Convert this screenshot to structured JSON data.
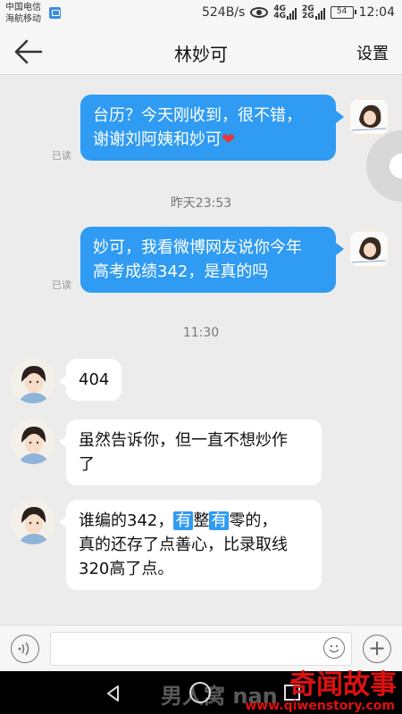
{
  "status_bar": {
    "carrier1": "中国电信",
    "carrier2": "海航移动",
    "net_speed": "524B/s",
    "network1": "4G",
    "network2": "4G",
    "network3": "2G",
    "network4": "2G",
    "battery": "54",
    "time": "12:04"
  },
  "header": {
    "title": "林妙可",
    "settings_label": "设置"
  },
  "messages": [
    {
      "line1": "台历？今天刚收到，很不错，",
      "line2": "谢谢刘阿姨和妙可",
      "heart": "❤",
      "status": "已读"
    },
    {
      "line1": "妙可，我看微博网友说你今年",
      "line2": "高考成绩342，是真的吗",
      "status": "已读"
    },
    {
      "text": "404"
    },
    {
      "line1": "虽然告诉你，但一直不想炒作",
      "line2": "了"
    },
    {
      "pre": "谁编的342，",
      "tag1": "有",
      "mid": "整",
      "tag2": "有",
      "post": "零的，",
      "line2": "真的还存了点善心，比录取线",
      "line3": "320高了点。"
    }
  ],
  "timestamps": {
    "t1": "昨天23:53",
    "t2": "11:30"
  },
  "watermark": {
    "left": "男人窝 nan",
    "title": "奇闻故事",
    "url": "www.qiwenstory.com"
  }
}
